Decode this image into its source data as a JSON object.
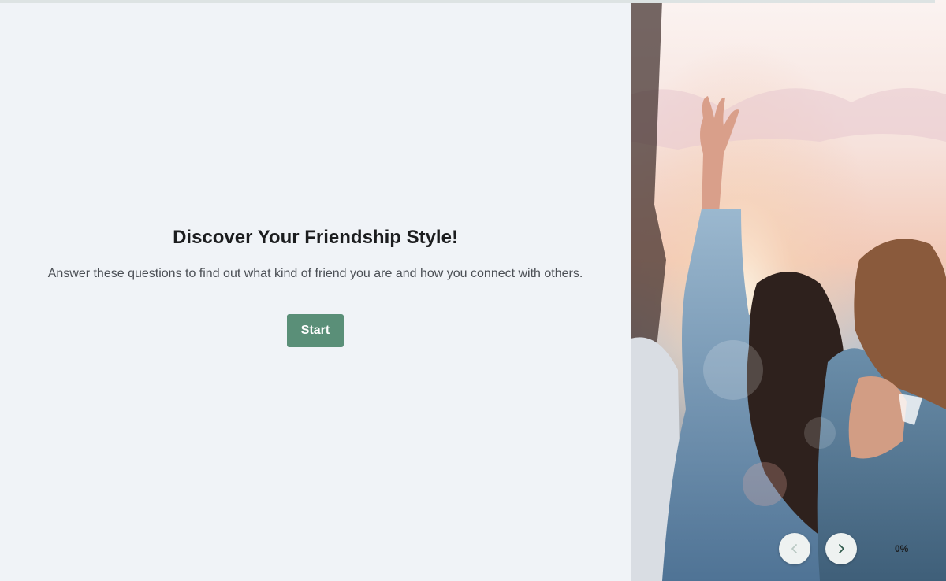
{
  "progress": {
    "value": 0,
    "label": "0%"
  },
  "intro": {
    "title": "Discover Your Friendship Style!",
    "description": "Answer these questions to find out what kind of friend you are and how you connect with others.",
    "start_label": "Start"
  },
  "hero": {
    "image_description": "Friends at sunset",
    "icons": {
      "prev": "chevron-left-icon",
      "next": "chevron-right-icon"
    }
  },
  "colors": {
    "accent": "#5a8f78",
    "background": "#f0f3f7",
    "text": "#1c1d1f"
  }
}
